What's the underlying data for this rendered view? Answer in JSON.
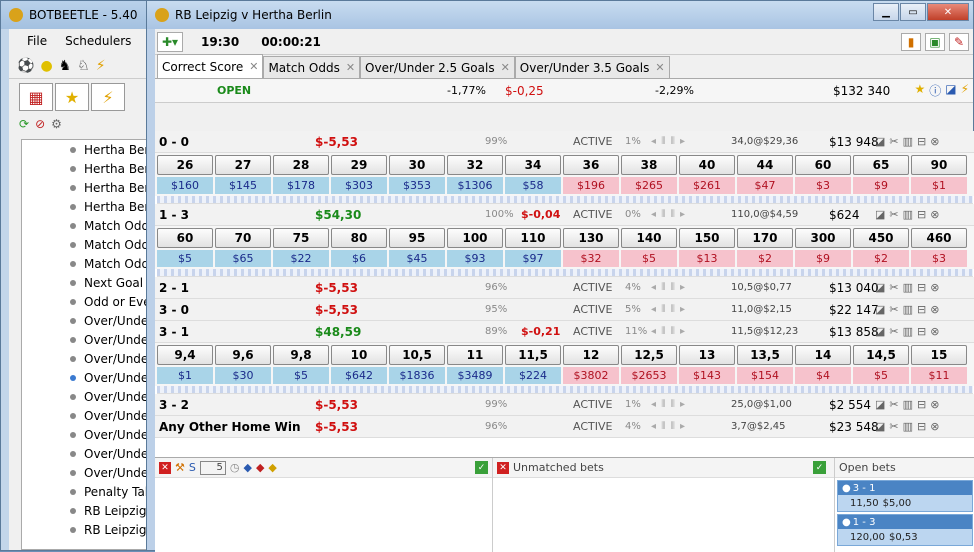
{
  "back_window": {
    "title": "BOTBEETLE - 5.40",
    "menu": [
      "File",
      "Schedulers"
    ],
    "tree_items": [
      {
        "label": "Hertha Ber",
        "dot": "grey"
      },
      {
        "label": "Hertha Ber",
        "dot": "grey"
      },
      {
        "label": "Hertha Ber",
        "dot": "grey"
      },
      {
        "label": "Hertha Ber",
        "dot": "grey"
      },
      {
        "label": "Match Odd",
        "dot": "grey"
      },
      {
        "label": "Match Odd",
        "dot": "grey"
      },
      {
        "label": "Match Odd",
        "dot": "grey"
      },
      {
        "label": "Next Goal",
        "dot": "grey"
      },
      {
        "label": "Odd or Eve",
        "dot": "grey"
      },
      {
        "label": "Over/Unde",
        "dot": "grey"
      },
      {
        "label": "Over/Unde",
        "dot": "grey"
      },
      {
        "label": "Over/Unde",
        "dot": "grey"
      },
      {
        "label": "Over/Unde",
        "dot": "blue"
      },
      {
        "label": "Over/Unde",
        "dot": "grey"
      },
      {
        "label": "Over/Unde",
        "dot": "grey"
      },
      {
        "label": "Over/Unde",
        "dot": "grey"
      },
      {
        "label": "Over/Unde",
        "dot": "grey"
      },
      {
        "label": "Over/Unde",
        "dot": "grey"
      },
      {
        "label": "Penalty Tal",
        "dot": "grey"
      },
      {
        "label": "RB Leipzig",
        "dot": "grey"
      },
      {
        "label": "RB Leipzig",
        "dot": "grey"
      }
    ]
  },
  "main_window": {
    "title": "RB Leipzig v Hertha Berlin",
    "time": "19:30",
    "timer": "00:00:21",
    "tabs": [
      {
        "label": "Correct Score",
        "active": true
      },
      {
        "label": "Match Odds",
        "active": false
      },
      {
        "label": "Over/Under 2.5 Goals",
        "active": false
      },
      {
        "label": "Over/Under 3.5 Goals",
        "active": false
      }
    ],
    "status": {
      "state": "OPEN",
      "pct_back": "-1,77%",
      "pl": "$-0,25",
      "pct_lay": "-2,29%",
      "total": "$132 340"
    },
    "rows_top": [
      {
        "name": "0 - 0",
        "pl": "$-5,53",
        "sign": "neg",
        "pct": "99%",
        "pl2": "",
        "active": "ACTIVE",
        "pct2": "1%",
        "avg": "34,0@$29,36",
        "amt": "$13 948",
        "ladder": [
          {
            "o": "26",
            "s": "$160",
            "t": "back"
          },
          {
            "o": "27",
            "s": "$145",
            "t": "back"
          },
          {
            "o": "28",
            "s": "$178",
            "t": "back"
          },
          {
            "o": "29",
            "s": "$303",
            "t": "back"
          },
          {
            "o": "30",
            "s": "$353",
            "t": "back"
          },
          {
            "o": "32",
            "s": "$1306",
            "t": "back"
          },
          {
            "o": "34",
            "s": "$58",
            "t": "back"
          },
          {
            "o": "36",
            "s": "$196",
            "t": "lay"
          },
          {
            "o": "38",
            "s": "$265",
            "t": "lay"
          },
          {
            "o": "40",
            "s": "$261",
            "t": "lay"
          },
          {
            "o": "44",
            "s": "$47",
            "t": "lay"
          },
          {
            "o": "60",
            "s": "$3",
            "t": "lay"
          },
          {
            "o": "65",
            "s": "$9",
            "t": "lay"
          },
          {
            "o": "90",
            "s": "$1",
            "t": "lay"
          }
        ]
      },
      {
        "name": "1 - 3",
        "pl": "$54,30",
        "sign": "pos",
        "pct": "100%",
        "pl2": "$-0,04",
        "active": "ACTIVE",
        "pct2": "0%",
        "avg": "110,0@$4,59",
        "amt": "$624",
        "ladder": [
          {
            "o": "60",
            "s": "$5",
            "t": "back"
          },
          {
            "o": "70",
            "s": "$65",
            "t": "back"
          },
          {
            "o": "75",
            "s": "$22",
            "t": "back"
          },
          {
            "o": "80",
            "s": "$6",
            "t": "back"
          },
          {
            "o": "95",
            "s": "$45",
            "t": "back"
          },
          {
            "o": "100",
            "s": "$93",
            "t": "back"
          },
          {
            "o": "110",
            "s": "$97",
            "t": "back"
          },
          {
            "o": "130",
            "s": "$32",
            "t": "lay"
          },
          {
            "o": "140",
            "s": "$5",
            "t": "lay"
          },
          {
            "o": "150",
            "s": "$13",
            "t": "lay"
          },
          {
            "o": "170",
            "s": "$2",
            "t": "lay"
          },
          {
            "o": "300",
            "s": "$9",
            "t": "lay"
          },
          {
            "o": "450",
            "s": "$2",
            "t": "lay"
          },
          {
            "o": "460",
            "s": "$3",
            "t": "lay"
          }
        ]
      }
    ],
    "rows_mid": [
      {
        "name": "2 - 1",
        "pl": "$-5,53",
        "sign": "neg",
        "pct": "96%",
        "pl2": "",
        "active": "ACTIVE",
        "pct2": "4%",
        "avg": "10,5@$0,77",
        "amt": "$13 040"
      },
      {
        "name": "3 - 0",
        "pl": "$-5,53",
        "sign": "neg",
        "pct": "95%",
        "pl2": "",
        "active": "ACTIVE",
        "pct2": "5%",
        "avg": "11,0@$2,15",
        "amt": "$22 147"
      }
    ],
    "row_31": {
      "name": "3 - 1",
      "pl": "$48,59",
      "sign": "pos",
      "pct": "89%",
      "pl2": "$-0,21",
      "active": "ACTIVE",
      "pct2": "11%",
      "avg": "11,5@$12,23",
      "amt": "$13 858",
      "ladder": [
        {
          "o": "9,4",
          "s": "$1",
          "t": "back"
        },
        {
          "o": "9,6",
          "s": "$30",
          "t": "back"
        },
        {
          "o": "9,8",
          "s": "$5",
          "t": "back"
        },
        {
          "o": "10",
          "s": "$642",
          "t": "back"
        },
        {
          "o": "10,5",
          "s": "$1836",
          "t": "back"
        },
        {
          "o": "11",
          "s": "$3489",
          "t": "back"
        },
        {
          "o": "11,5",
          "s": "$224",
          "t": "back"
        },
        {
          "o": "12",
          "s": "$3802",
          "t": "lay"
        },
        {
          "o": "12,5",
          "s": "$2653",
          "t": "lay"
        },
        {
          "o": "13",
          "s": "$143",
          "t": "lay"
        },
        {
          "o": "13,5",
          "s": "$154",
          "t": "lay"
        },
        {
          "o": "14",
          "s": "$4",
          "t": "lay"
        },
        {
          "o": "14,5",
          "s": "$5",
          "t": "lay"
        },
        {
          "o": "15",
          "s": "$11",
          "t": "lay"
        }
      ]
    },
    "rows_bottom": [
      {
        "name": "3 - 2",
        "pl": "$-5,53",
        "sign": "neg",
        "pct": "99%",
        "pl2": "",
        "active": "ACTIVE",
        "pct2": "1%",
        "avg": "25,0@$1,00",
        "amt": "$2 554"
      },
      {
        "name": "Any Other Home Win",
        "pl": "$-5,53",
        "sign": "neg",
        "pct": "96%",
        "pl2": "",
        "active": "ACTIVE",
        "pct2": "4%",
        "avg": "3,7@$2,45",
        "amt": "$23 548"
      }
    ],
    "bottom": {
      "spinner_value": "5",
      "unmatched_label": "Unmatched bets",
      "open_label": "Open bets",
      "open_bets": [
        {
          "selection": "3 - 1",
          "odds": "11,50",
          "stake": "$5,00"
        },
        {
          "selection": "1 - 3",
          "odds": "120,00",
          "stake": "$0,53"
        }
      ]
    }
  }
}
